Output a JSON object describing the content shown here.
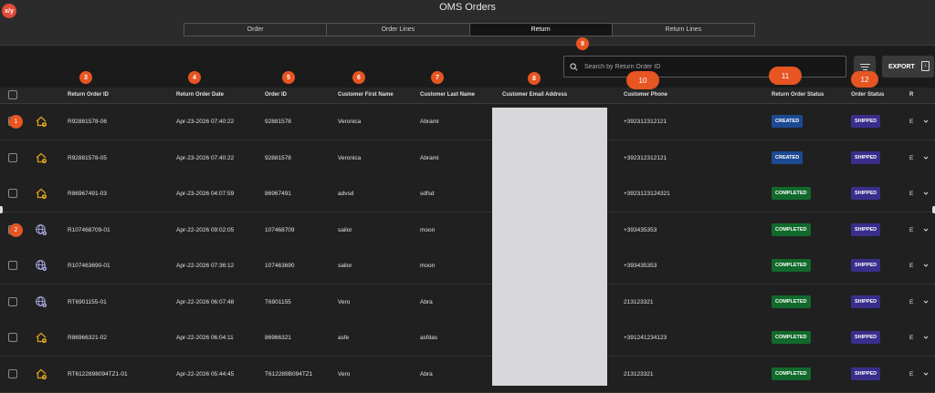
{
  "app": {
    "badge": "x/y",
    "title": "OMS Orders"
  },
  "tabs": [
    "Order",
    "Order Lines",
    "Return",
    "Return Lines"
  ],
  "active_tab": "Return",
  "search": {
    "placeholder": "Search by Return Order ID",
    "value": ""
  },
  "export": {
    "label": "EXPORT"
  },
  "columns": [
    "Return Order ID",
    "Return Order Date",
    "Order ID",
    "Customer First Name",
    "Customer Last Name",
    "Customer Email Address",
    "Customer Phone",
    "Return Order Status",
    "Order Status",
    "R"
  ],
  "markers": [
    "3",
    "4",
    "5",
    "6",
    "7",
    "8",
    "9",
    "10",
    "11",
    "12"
  ],
  "rows": [
    {
      "marker": "1",
      "icon": "house-clock-icon",
      "return_order_id": "R92881578-06",
      "date": "Apr-23-2026 07:40:22",
      "order_id": "92881578",
      "first": "Veronica",
      "last": "Abrami",
      "phone": "+392312312121",
      "return_status": "CREATED",
      "order_status": "SHIPPED",
      "r": "E"
    },
    {
      "marker": "",
      "icon": "house-clock-icon",
      "return_order_id": "R92881578-05",
      "date": "Apr-23-2026 07:40:22",
      "order_id": "92881578",
      "first": "Veronica",
      "last": "Abrami",
      "phone": "+392312312121",
      "return_status": "CREATED",
      "order_status": "SHIPPED",
      "r": "E"
    },
    {
      "marker": "",
      "icon": "house-clock-icon",
      "return_order_id": "R86967491-03",
      "date": "Apr-23-2026 04:07:59",
      "order_id": "86967491",
      "first": "advsd",
      "last": "sdfsd",
      "phone": "+3923123124321",
      "return_status": "COMPLETED",
      "order_status": "SHIPPED",
      "r": "E"
    },
    {
      "marker": "2",
      "icon": "globe-gear-icon",
      "return_order_id": "R107468709-01",
      "date": "Apr-22-2026 09:02:05",
      "order_id": "107468709",
      "first": "sailor",
      "last": "moon",
      "phone": "+393435353",
      "return_status": "COMPLETED",
      "order_status": "SHIPPED",
      "r": "E"
    },
    {
      "marker": "",
      "icon": "globe-gear-icon",
      "return_order_id": "R107463690-01",
      "date": "Apr-22-2026 07:36:12",
      "order_id": "107463690",
      "first": "sailor",
      "last": "moon",
      "phone": "+393435353",
      "return_status": "COMPLETED",
      "order_status": "SHIPPED",
      "r": "E"
    },
    {
      "marker": "",
      "icon": "globe-gear-icon",
      "return_order_id": "RT6901155-01",
      "date": "Apr-22-2026 06:07:48",
      "order_id": "T6901155",
      "first": "Vero",
      "last": "Abra",
      "phone": "213123321",
      "return_status": "COMPLETED",
      "order_status": "SHIPPED",
      "r": "E"
    },
    {
      "marker": "",
      "icon": "house-clock-icon",
      "return_order_id": "R86966321-02",
      "date": "Apr-22-2026 06:04:11",
      "order_id": "86966321",
      "first": "asfe",
      "last": "asfdas",
      "phone": "+391241234123",
      "return_status": "COMPLETED",
      "order_status": "SHIPPED",
      "r": "E"
    },
    {
      "marker": "",
      "icon": "house-clock-icon",
      "return_order_id": "RT6122898094TZ1-01",
      "date": "Apr-22-2026 05:44:45",
      "order_id": "T612289B094TZ1",
      "first": "Vero",
      "last": "Abra",
      "phone": "213123321",
      "return_status": "COMPLETED",
      "order_status": "SHIPPED",
      "r": "E"
    }
  ]
}
